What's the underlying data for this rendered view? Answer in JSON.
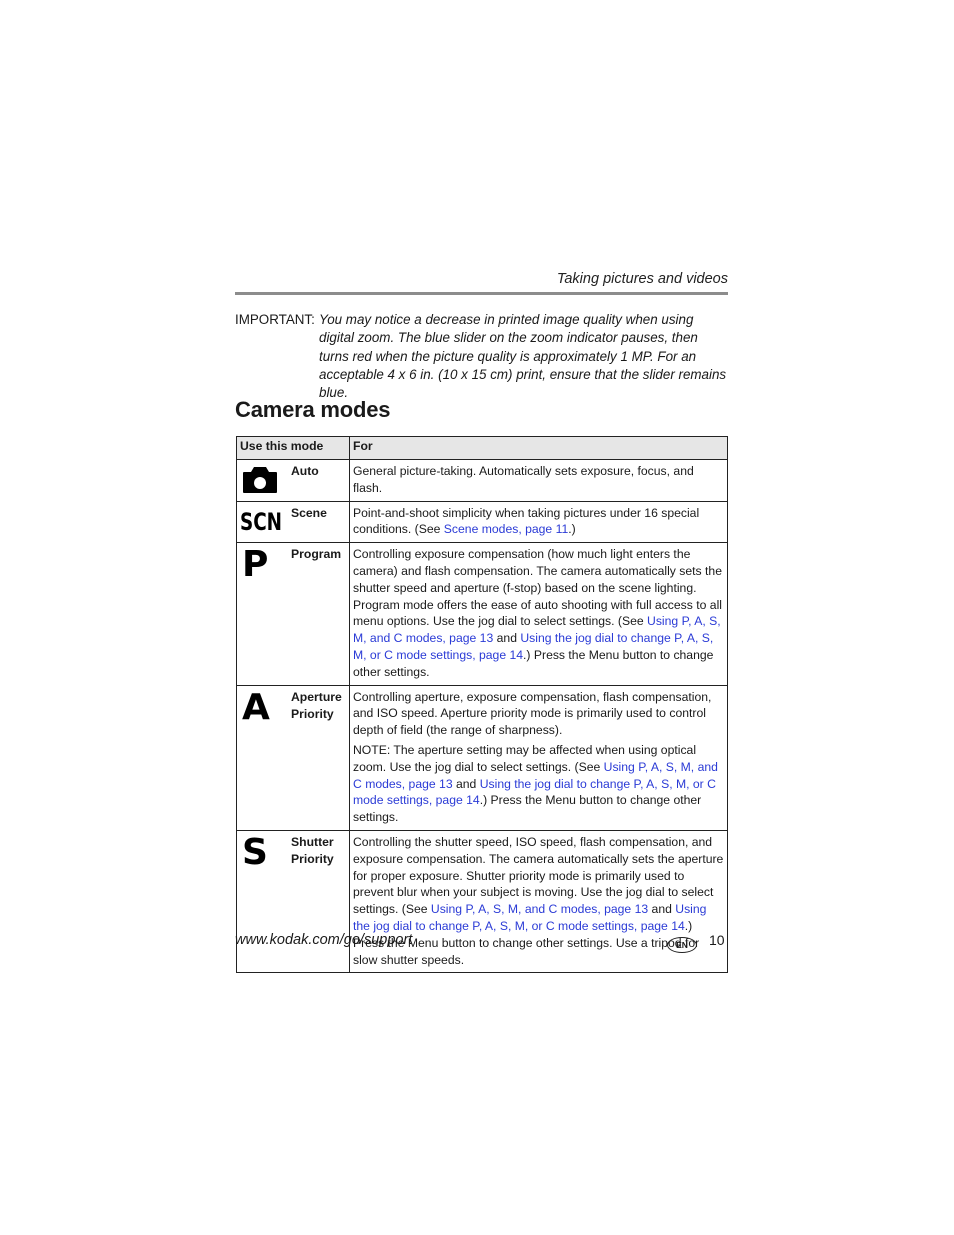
{
  "header": {
    "running_head": "Taking pictures and videos"
  },
  "important": {
    "label": "IMPORTANT:",
    "text": "You may notice a decrease in printed image quality when using digital zoom. The blue slider on the zoom indicator pauses, then turns red when the picture quality is approximately 1 MP. For an acceptable 4 x 6 in. (10 x 15 cm) print, ensure that the slider remains blue."
  },
  "section_title": "Camera modes",
  "table": {
    "headers": [
      "Use this mode",
      "For"
    ],
    "rows": [
      {
        "icon": "camera-icon",
        "mode_lines": [
          "Auto"
        ],
        "text": "General picture-taking. Automatically sets exposure, focus, and flash."
      },
      {
        "icon": "scn-icon",
        "icon_text": "SCN",
        "mode_lines": [
          "Scene"
        ],
        "text_before": "Point-and-shoot simplicity when taking pictures under 16 special conditions. (See ",
        "link1": "Scene modes, page 11",
        "text_after": ".)"
      },
      {
        "icon": "program-p-icon",
        "icon_text": "P",
        "mode_lines": [
          "Program"
        ],
        "text_before": "Controlling exposure compensation (how much light enters the camera) and flash compensation. The camera automatically sets the shutter speed and aperture (f-stop) based on the scene lighting. Program mode offers the ease of auto shooting with full access to all menu options. Use the jog dial to select settings. (See ",
        "link1": "Using P, A, S, M, and C modes, page 13",
        "mid": " and ",
        "link2": "Using the jog dial to change P, A, S, M, or C mode settings, page 14",
        "text_after": ".) Press the Menu button to change other settings."
      },
      {
        "icon": "aperture-a-icon",
        "icon_text": "A",
        "mode_lines": [
          "Aperture",
          "Priority"
        ],
        "text": "Controlling aperture, exposure compensation, flash compensation, and ISO speed. Aperture priority mode is primarily used to control depth of field (the range of sharpness).",
        "note_before": "NOTE: The aperture setting may be affected when using optical zoom. Use the jog dial to select settings. (See ",
        "link1": "Using P, A, S, M, and C modes, page 13",
        "mid": " and ",
        "link2": "Using the jog dial to change P, A, S, M, or C mode settings, page 14",
        "text_after": ".) Press the Menu button to change other settings."
      },
      {
        "icon": "shutter-s-icon",
        "icon_text": "S",
        "mode_lines": [
          "Shutter",
          "Priority"
        ],
        "text_before": "Controlling the shutter speed, ISO speed, flash compensation, and exposure compensation. The camera automatically sets the aperture for proper exposure. Shutter priority mode is primarily used to prevent blur when your subject is moving. Use the jog dial to select settings. (See ",
        "link1": "Using P, A, S, M, and C modes, page 13",
        "mid": " and ",
        "link2": "Using the jog dial to change P, A, S, M, or C mode settings, page 14",
        "text_after": ".) Press the Menu button to change other settings. Use a tripod for slow shutter speeds."
      }
    ]
  },
  "footer": {
    "url": "www.kodak.com/go/support",
    "language_badge": "EN",
    "page_number": "10"
  },
  "colors": {
    "link": "#2b3bd6",
    "header_bg": "#e6e6e6",
    "rule": "#8c8c8c"
  }
}
